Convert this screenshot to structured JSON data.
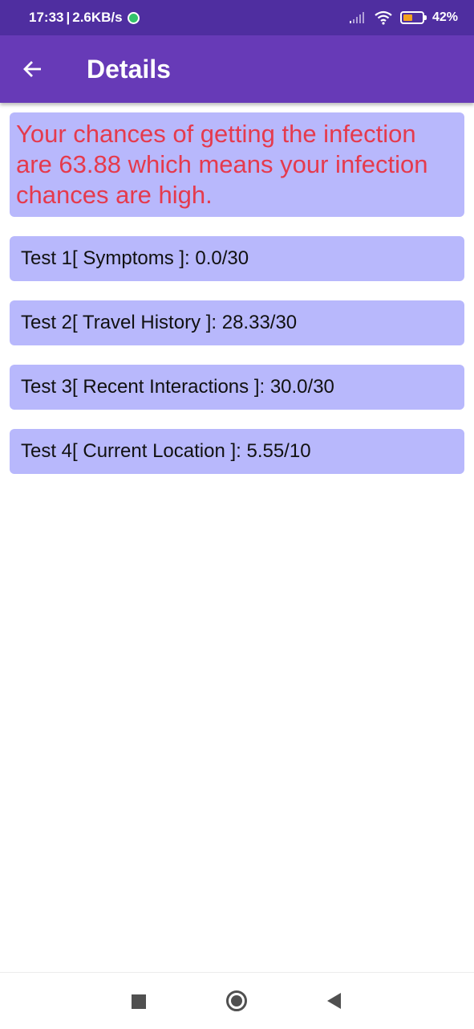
{
  "status_bar": {
    "time": "17:33",
    "separator": "|",
    "speed": "2.6KB/s",
    "battery": "42%"
  },
  "app_bar": {
    "title": "Details"
  },
  "result": {
    "text": "Your chances of getting the infection are 63.88 which means your infection chances are high."
  },
  "tests": [
    {
      "label": "Test 1[ Symptoms ]: 0.0/30"
    },
    {
      "label": "Test 2[ Travel History ]: 28.33/30"
    },
    {
      "label": "Test 3[ Recent Interactions ]: 30.0/30"
    },
    {
      "label": "Test 4[ Current Location ]: 5.55/10"
    }
  ],
  "colors": {
    "status_bar": "#4f2ea0",
    "app_bar": "#673ab7",
    "card": "#b8b8fc",
    "result_text": "#e53a4d"
  },
  "icons": {
    "back": "arrow-left-icon",
    "whatsapp": "whatsapp-icon",
    "signal": "signal-icon",
    "wifi": "wifi-icon",
    "battery": "battery-icon",
    "nav_recents": "square-icon",
    "nav_home": "circle-icon",
    "nav_back": "triangle-icon"
  }
}
